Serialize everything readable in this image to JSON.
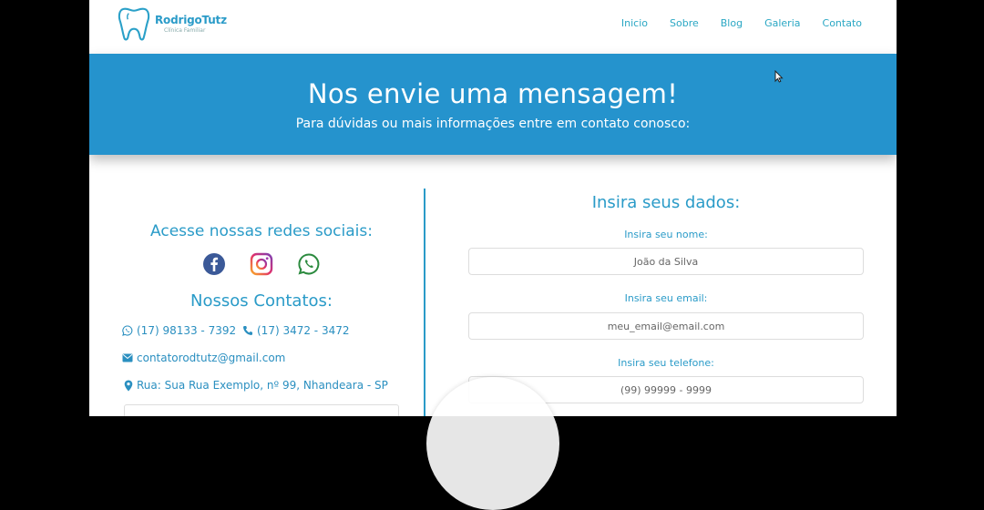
{
  "brand": {
    "name": "RodrigoTutz",
    "tagline": "Clínica Familiar"
  },
  "nav": [
    "Inicio",
    "Sobre",
    "Blog",
    "Galeria",
    "Contato"
  ],
  "banner": {
    "title": "Nos envie uma mensagem!",
    "subtitle": "Para dúvidas ou mais informações entre em contato conosco:"
  },
  "social": {
    "title": "Acesse nossas redes sociais:",
    "icons": [
      "facebook-icon",
      "instagram-icon",
      "whatsapp-icon"
    ]
  },
  "contacts": {
    "title": "Nossos Contatos:",
    "whatsapp": "(17) 98133 - 7392",
    "phone": "(17) 3472 - 3472",
    "email": "contatorodtutz@gmail.com",
    "address": "Rua: Sua Rua Exemplo, nº 99, Nhandeara - SP"
  },
  "form": {
    "title": "Insira seus dados:",
    "name_label": "Insira seu nome:",
    "name_placeholder": "João da Silva",
    "email_label": "Insira seu email:",
    "email_placeholder": "meu_email@email.com",
    "phone_label": "Insira seu telefone:",
    "phone_placeholder": "(99) 99999 - 9999"
  },
  "colors": {
    "accent": "#2a9bc8",
    "banner": "#2593cd"
  }
}
